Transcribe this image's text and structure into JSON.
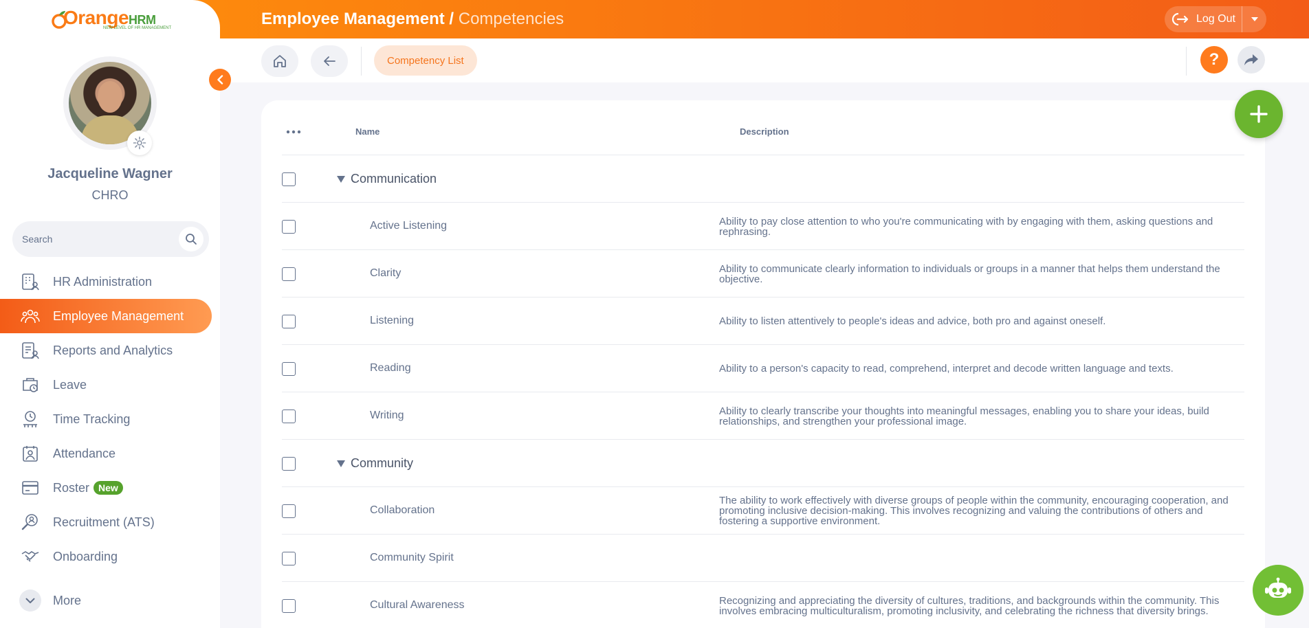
{
  "header": {
    "title": "Employee Management /",
    "subtitle": "Competencies",
    "logout_label": "Log Out"
  },
  "sidebar": {
    "logo_main": "Orange",
    "logo_suffix": "HRM",
    "logo_tagline": "NEW LEVEL OF HR MANAGEMENT",
    "user_name": "Jacqueline Wagner",
    "user_role": "CHRO",
    "search_placeholder": "Search",
    "items": [
      {
        "label": "HR Administration",
        "icon": "hr-admin-icon"
      },
      {
        "label": "Employee Management",
        "icon": "employee-icon",
        "active": true
      },
      {
        "label": "Reports and Analytics",
        "icon": "reports-icon"
      },
      {
        "label": "Leave",
        "icon": "leave-icon"
      },
      {
        "label": "Time Tracking",
        "icon": "time-icon"
      },
      {
        "label": "Attendance",
        "icon": "attendance-icon"
      },
      {
        "label": "Roster",
        "icon": "roster-icon",
        "badge": "New"
      },
      {
        "label": "Recruitment (ATS)",
        "icon": "recruitment-icon"
      },
      {
        "label": "Onboarding",
        "icon": "onboarding-icon"
      }
    ],
    "more_label": "More"
  },
  "toolbar": {
    "tab_label": "Competency List"
  },
  "table": {
    "columns": {
      "name": "Name",
      "description": "Description"
    },
    "rows": [
      {
        "type": "group",
        "name": "Communication",
        "description": ""
      },
      {
        "type": "item",
        "name": "Active Listening",
        "description": "Ability to pay close attention to who you're communicating with by engaging with them, asking questions and rephrasing."
      },
      {
        "type": "item",
        "name": "Clarity",
        "description": "Ability to communicate clearly information to individuals or groups in a manner that helps them understand the objective."
      },
      {
        "type": "item",
        "name": "Listening",
        "description": "Ability to listen attentively to people's ideas and advice, both pro and against oneself."
      },
      {
        "type": "item",
        "name": "Reading",
        "description": "Ability to a person's capacity to read, comprehend, interpret and decode written language and texts."
      },
      {
        "type": "item",
        "name": "Writing",
        "description": "Ability to clearly transcribe your thoughts into meaningful messages, enabling you to share your ideas, build relationships, and strengthen your professional image."
      },
      {
        "type": "group",
        "name": "Community",
        "description": ""
      },
      {
        "type": "item",
        "name": "Collaboration",
        "description": "The ability to work effectively with diverse groups of people within the community, encouraging cooperation, and promoting inclusive decision-making. This involves recognizing and valuing the contributions of others and fostering a supportive environment."
      },
      {
        "type": "item",
        "name": "Community Spirit",
        "description": ""
      },
      {
        "type": "item",
        "name": "Cultural Awareness",
        "description": "Recognizing and appreciating the diversity of cultures, traditions, and backgrounds within the community. This involves embracing multiculturalism, promoting inclusivity, and celebrating the richness that diversity brings."
      }
    ]
  },
  "colors": {
    "brand_orange": "#f35c17",
    "accent_green": "#6bb52f",
    "text": "#64728c"
  }
}
